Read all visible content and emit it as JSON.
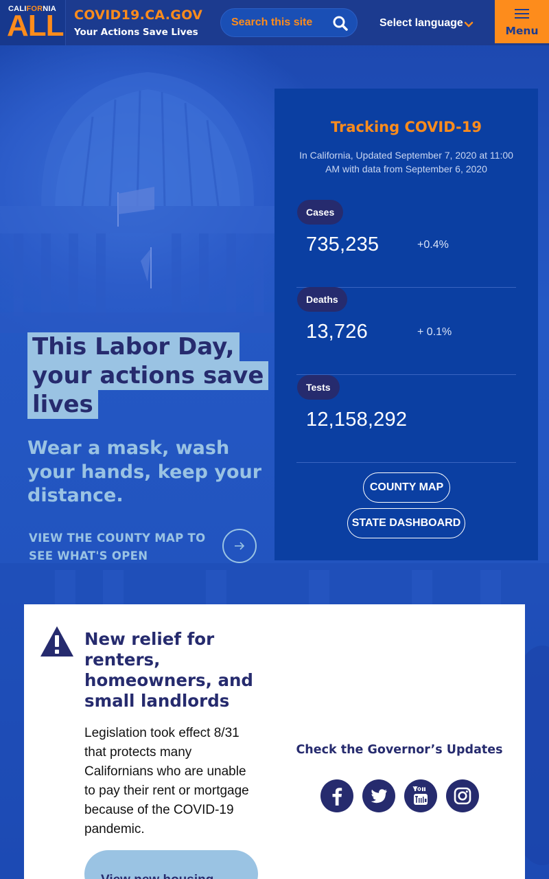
{
  "header": {
    "logo_top_white_1": "CALI",
    "logo_top_orange": "FOR",
    "logo_top_white_2": "NIA",
    "logo_main": "ALL",
    "site_title": "COVID19.CA.GOV",
    "tagline": "Your Actions Save Lives",
    "search_placeholder": "Search this site",
    "language_label": "Select language",
    "menu_label": "Menu"
  },
  "hero": {
    "title": "This Labor Day, your actions save lives",
    "subtitle": "Wear a mask, wash your hands, keep your distance.",
    "link_text": "VIEW THE COUNTY MAP TO SEE WHAT'S OPEN"
  },
  "tracker": {
    "title": "Tracking COVID-19",
    "updated": "In California, Updated September 7, 2020 at 11:00 AM with data from September 6, 2020",
    "stats": [
      {
        "label": "Cases",
        "value": "735,235",
        "change": "+0.4%"
      },
      {
        "label": "Deaths",
        "value": "13,726",
        "change": "+ 0.1%"
      },
      {
        "label": "Tests",
        "value": "12,158,292",
        "change": ""
      }
    ],
    "county_map_label": "COUNTY MAP",
    "state_dashboard_label": "STATE DASHBOARD"
  },
  "card": {
    "heading": "New relief for renters, homeowners, and small landlords",
    "body": "Legislation took effect 8/31 that protects many Californians who are unable to pay their rent or mortgage because of the COVID-19 pandemic.",
    "button_label": "View new housing",
    "governor_updates": "Check the Governor’s Updates",
    "social": [
      "facebook-icon",
      "twitter-icon",
      "youtube-icon",
      "instagram-icon"
    ]
  },
  "colors": {
    "navy": "#1c3b8f",
    "orange": "#fd8c1c",
    "panel_blue": "#0b3fa2",
    "light_blue": "#9ac3e3",
    "dark_indigo": "#262b6e"
  }
}
